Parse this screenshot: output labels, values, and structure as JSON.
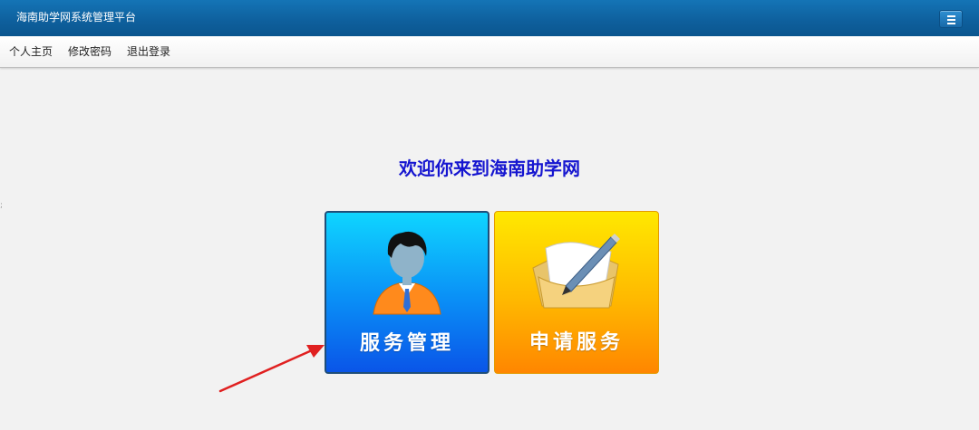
{
  "header": {
    "app_title": "海南助学网系统管理平台",
    "menu_icon": "hamburger-menu-icon"
  },
  "nav": {
    "items": [
      {
        "label": "个人主页"
      },
      {
        "label": "修改密码"
      },
      {
        "label": "退出登录"
      }
    ]
  },
  "main": {
    "welcome_text": "欢迎你来到海南助学网",
    "tiles": [
      {
        "label": "服务管理",
        "icon": "user-avatar-icon",
        "color_top": "#0fd5ff",
        "color_bottom": "#0a55e8"
      },
      {
        "label": "申请服务",
        "icon": "envelope-pen-icon",
        "color_top": "#ffe800",
        "color_bottom": "#ff8600"
      }
    ],
    "annotation": {
      "icon": "red-arrow-icon",
      "color": "#e02020"
    }
  },
  "colors": {
    "header_bg": "#0e5f9c",
    "welcome_text": "#1616d0",
    "page_bg": "#f2f2f2"
  },
  "edge_mark": ";"
}
